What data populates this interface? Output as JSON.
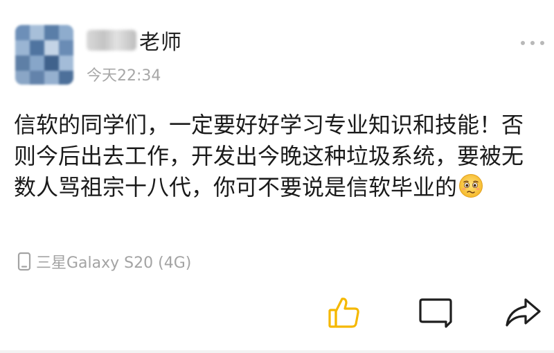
{
  "post": {
    "author_suffix": "老师",
    "time": "今天22:34",
    "content": "信软的同学们，一定要好好学习专业知识和技能！否则今后出去工作，开发出今晚这种垃圾系统，要被无数人骂祖宗十八代，你可不要说是信软毕业的",
    "emoji": "woozy-face-emoji",
    "device": "三星Galaxy S20 (4G)"
  },
  "icons": {
    "more": "more-dots-icon",
    "device": "phone-icon",
    "like": "thumbs-up-icon",
    "comment": "comment-icon",
    "share": "share-icon"
  },
  "colors": {
    "like_accent": "#f5b800",
    "meta_gray": "#a7a7a7",
    "icon_dark": "#1f1f1f"
  }
}
